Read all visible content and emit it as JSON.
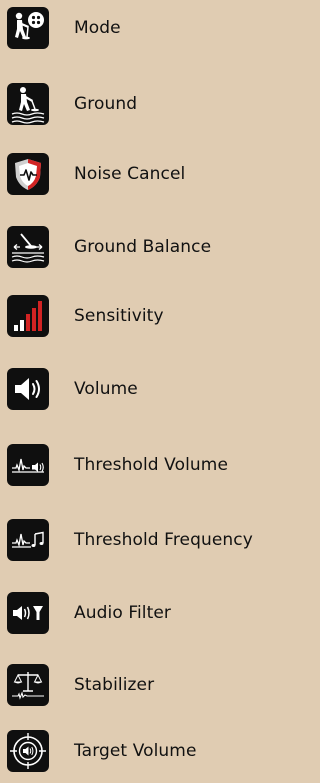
{
  "menu": {
    "items": [
      {
        "label": "Mode",
        "icon": "detector-person-mode-icon"
      },
      {
        "label": "Ground",
        "icon": "ground-detector-icon"
      },
      {
        "label": "Noise Cancel",
        "icon": "noise-cancel-shield-icon"
      },
      {
        "label": "Ground Balance",
        "icon": "ground-balance-icon"
      },
      {
        "label": "Sensitivity",
        "icon": "sensitivity-bars-icon"
      },
      {
        "label": "Volume",
        "icon": "volume-speaker-icon"
      },
      {
        "label": "Threshold Volume",
        "icon": "threshold-volume-icon"
      },
      {
        "label": "Threshold Frequency",
        "icon": "threshold-frequency-icon"
      },
      {
        "label": "Audio Filter",
        "icon": "audio-filter-icon"
      },
      {
        "label": "Stabilizer",
        "icon": "stabilizer-scale-icon"
      },
      {
        "label": "Target Volume",
        "icon": "target-volume-icon"
      }
    ]
  },
  "colors": {
    "background": "#e0ccb2",
    "icon_tile": "#0f0f0f",
    "accent_red": "#d22323",
    "text": "#111111"
  }
}
